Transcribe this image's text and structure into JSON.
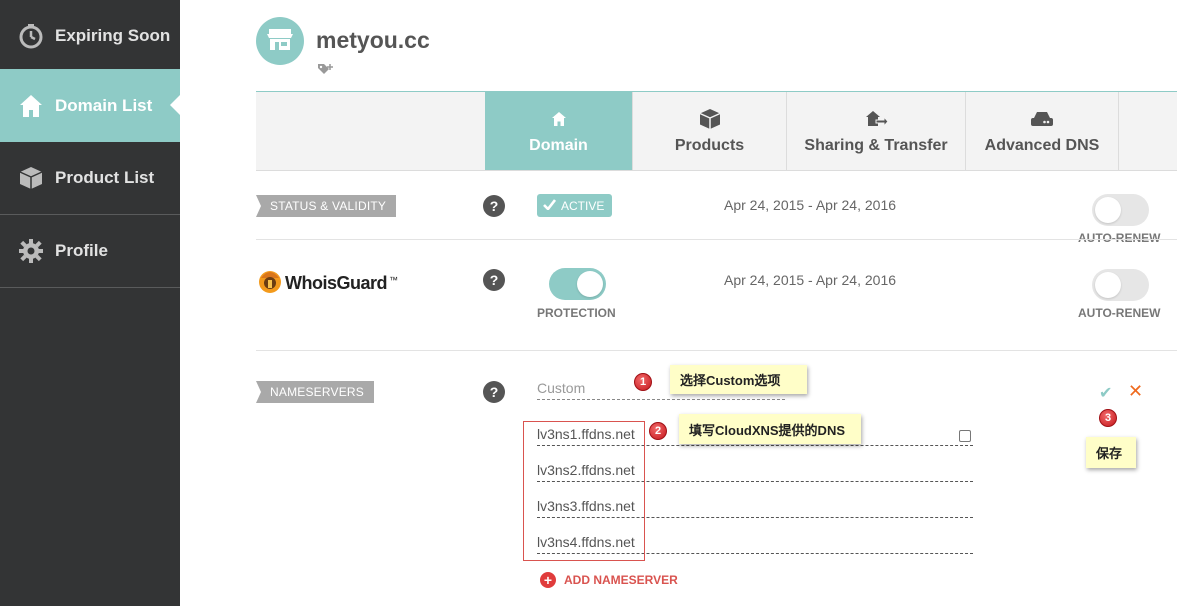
{
  "sidebar": {
    "items": [
      {
        "label": "Expiring Soon",
        "icon": "stopwatch-icon"
      },
      {
        "label": "Domain List",
        "icon": "home-icon"
      },
      {
        "label": "Product List",
        "icon": "box-icon"
      },
      {
        "label": "Profile",
        "icon": "gear-icon"
      }
    ],
    "active_index": 1
  },
  "header": {
    "domain": "metyou.cc",
    "avatar_icon": "store-icon"
  },
  "tabs": [
    {
      "label": "Domain",
      "icon": "home-icon"
    },
    {
      "label": "Products",
      "icon": "box-icon"
    },
    {
      "label": "Sharing & Transfer",
      "icon": "transfer-icon"
    },
    {
      "label": "Advanced DNS",
      "icon": "server-icon"
    }
  ],
  "status": {
    "label": "STATUS & VALIDITY",
    "badge": "ACTIVE",
    "dates": "Apr 24, 2015 - Apr 24, 2016",
    "toggle_label": "AUTO-RENEW",
    "toggle_on": false
  },
  "whoisguard": {
    "logo_text": "WhoisGuard",
    "tm": "™",
    "protection_label": "PROTECTION",
    "protection_on": true,
    "dates": "Apr 24, 2015 - Apr 24, 2016",
    "toggle_label": "AUTO-RENEW",
    "toggle_on": false
  },
  "nameservers": {
    "label": "NAMESERVERS",
    "mode": "Custom",
    "servers": [
      "lv3ns1.ffdns.net",
      "lv3ns2.ffdns.net",
      "lv3ns3.ffdns.net",
      "lv3ns4.ffdns.net"
    ],
    "add_label": "ADD NAMESERVER"
  },
  "help_glyph": "?",
  "annotations": [
    {
      "number": "1",
      "text": "选择Custom选项"
    },
    {
      "number": "2",
      "text": "填写CloudXNS提供的DNS"
    },
    {
      "number": "3",
      "text": "保存"
    }
  ],
  "colors": {
    "sidebar_bg": "#333435",
    "accent": "#8ecbc6",
    "label_gray": "#a9a9a9",
    "danger": "#d9534f",
    "note_bg": "#fffec8"
  }
}
